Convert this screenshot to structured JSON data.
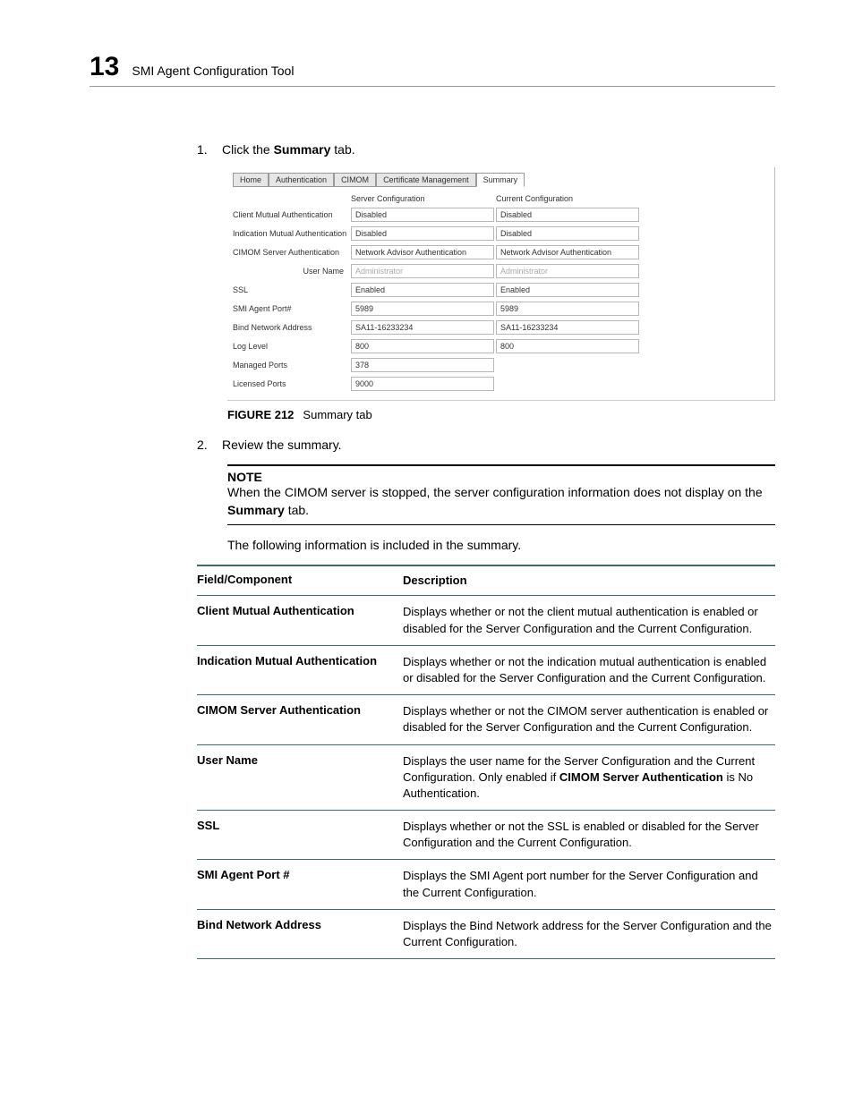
{
  "header": {
    "chapter": "13",
    "title": "SMI Agent Configuration Tool"
  },
  "steps": {
    "s1": {
      "num": "1.",
      "pre": "Click the ",
      "bold": "Summary",
      "post": " tab."
    },
    "s2": {
      "num": "2.",
      "text": "Review the summary."
    }
  },
  "screenshot": {
    "tabs": {
      "home": "Home",
      "auth": "Authentication",
      "cimom": "CIMOM",
      "cert": "Certificate Management",
      "summary": "Summary"
    },
    "headers": {
      "server": "Server Configuration",
      "current": "Current Configuration"
    },
    "rows": {
      "cma": {
        "label": "Client Mutual Authentication",
        "server": "Disabled",
        "current": "Disabled"
      },
      "ima": {
        "label": "Indication Mutual Authentication",
        "server": "Disabled",
        "current": "Disabled"
      },
      "csa": {
        "label": "CIMOM Server Authentication",
        "server": "Network Advisor Authentication",
        "current": "Network Advisor Authentication"
      },
      "user": {
        "label": "User Name",
        "server": "Administrator",
        "current": "Administrator"
      },
      "ssl": {
        "label": "SSL",
        "server": "Enabled",
        "current": "Enabled"
      },
      "port": {
        "label": "SMI Agent Port#",
        "server": "5989",
        "current": "5989"
      },
      "bind": {
        "label": "Bind Network Address",
        "server": "SA11-16233234",
        "current": "SA11-16233234"
      },
      "log": {
        "label": "Log Level",
        "server": "800",
        "current": "800"
      },
      "mp": {
        "label": "Managed Ports",
        "server": "378"
      },
      "lp": {
        "label": "Licensed Ports",
        "server": "9000"
      }
    }
  },
  "figure": {
    "label": "FIGURE 212",
    "caption": "Summary tab"
  },
  "note": {
    "label": "NOTE",
    "pre": "When the CIMOM server is stopped, the server configuration information does not display on the ",
    "bold": "Summary",
    "post": " tab."
  },
  "intro": "The following information is included in the summary.",
  "deftable": {
    "head": {
      "c1": "Field/Component",
      "c2": "Description"
    },
    "rows": {
      "r1": {
        "field": "Client Mutual Authentication",
        "desc": "Displays whether or not the client mutual authentication is enabled or disabled for the Server Configuration and the Current Configuration."
      },
      "r2": {
        "field": "Indication Mutual Authentication",
        "desc": "Displays whether or not the indication mutual authentication is enabled or disabled for the Server Configuration and the Current Configuration."
      },
      "r3": {
        "field": "CIMOM Server Authentication",
        "desc": "Displays whether or not the CIMOM server authentication is enabled or disabled for the Server Configuration and the Current Configuration."
      },
      "r4": {
        "field": "User Name",
        "desc_pre": "Displays the user name for the Server Configuration and the Current Configuration. Only enabled if ",
        "desc_bold": "CIMOM Server Authentication",
        "desc_post": " is No Authentication."
      },
      "r5": {
        "field": "SSL",
        "desc": "Displays whether or not the SSL is enabled or disabled for the Server Configuration and the Current Configuration."
      },
      "r6": {
        "field": "SMI Agent Port #",
        "desc": "Displays the SMI Agent port number for the Server Configuration and the Current Configuration."
      },
      "r7": {
        "field": "Bind Network Address",
        "desc": "Displays the Bind Network address for the Server Configuration and the Current Configuration."
      }
    }
  }
}
